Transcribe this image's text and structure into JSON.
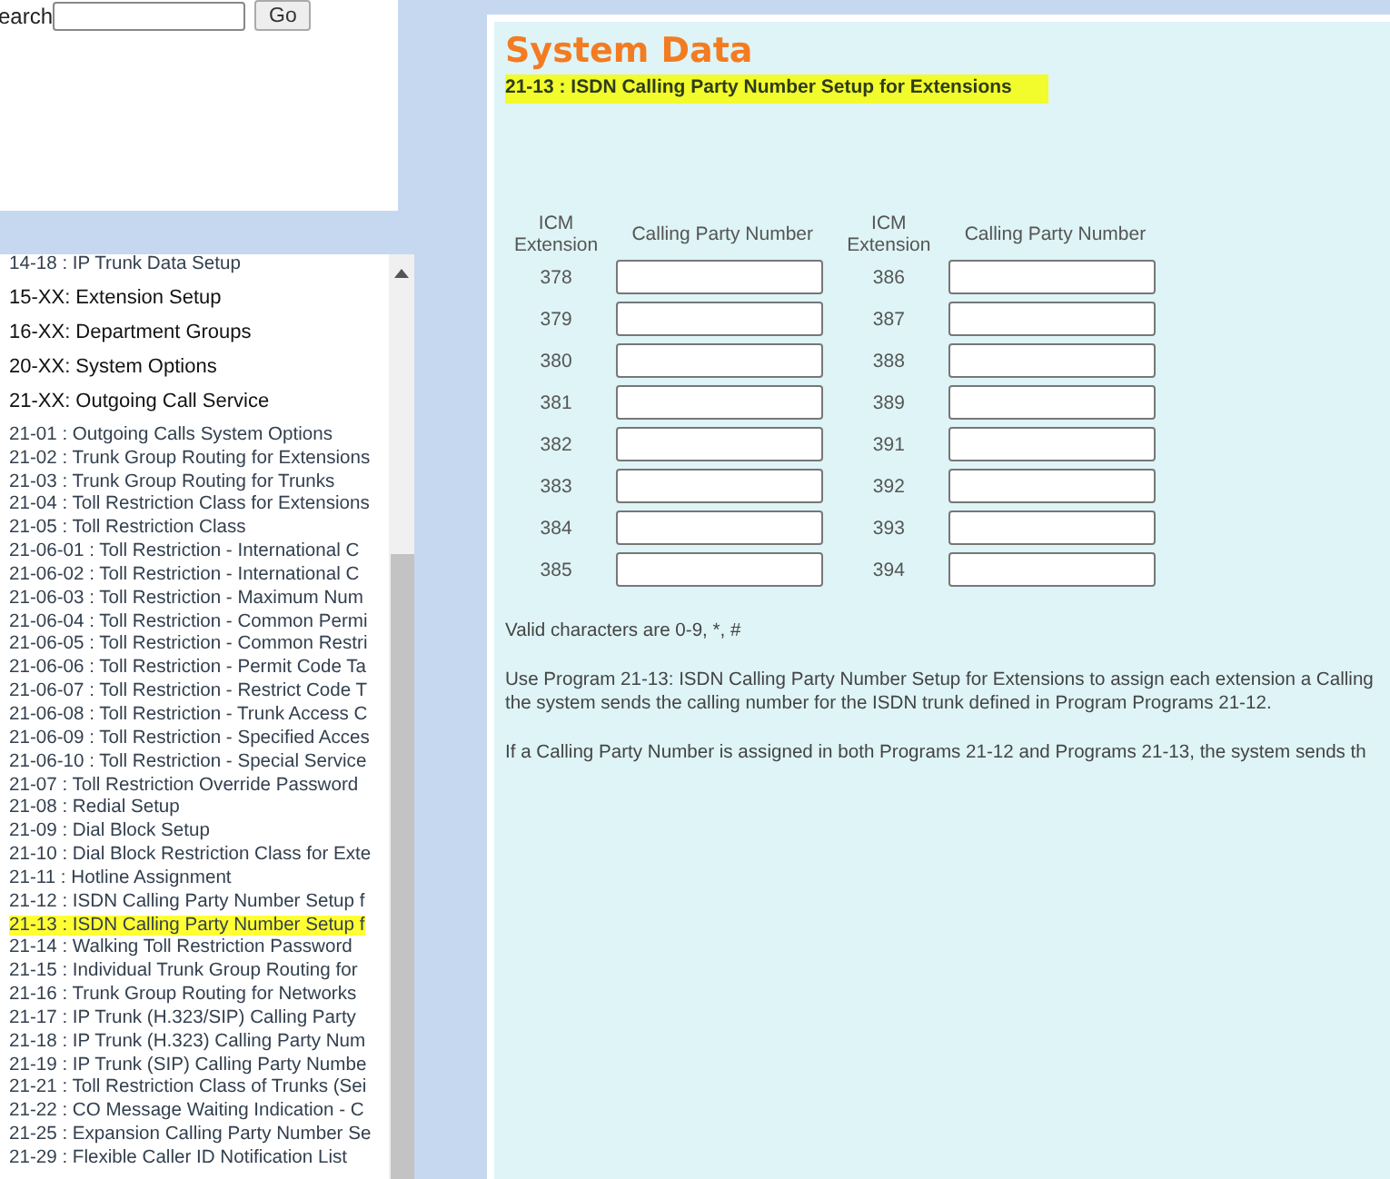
{
  "search": {
    "label": "earch",
    "button": "Go"
  },
  "nav": {
    "items": [
      {
        "kind": "item",
        "label": "14-18 : IP Trunk Data Setup",
        "selected": false
      },
      {
        "kind": "heading",
        "label": "15-XX: Extension Setup",
        "selected": false
      },
      {
        "kind": "heading",
        "label": "16-XX: Department Groups",
        "selected": false
      },
      {
        "kind": "heading",
        "label": "20-XX: System Options",
        "selected": false
      },
      {
        "kind": "heading",
        "label": "21-XX: Outgoing Call Service",
        "selected": false
      },
      {
        "kind": "item",
        "label": "21-01 : Outgoing Calls System Options",
        "selected": false
      },
      {
        "kind": "item",
        "label": "21-02 : Trunk Group Routing for Extensions",
        "selected": false
      },
      {
        "kind": "item",
        "label": "21-03 : Trunk Group Routing for Trunks",
        "selected": false
      },
      {
        "kind": "item",
        "label": "21-04 : Toll Restriction Class for Extensions",
        "selected": false
      },
      {
        "kind": "item",
        "label": "21-05 : Toll Restriction Class",
        "selected": false
      },
      {
        "kind": "item",
        "label": "21-06-01 : Toll Restriction - International C",
        "selected": false
      },
      {
        "kind": "item",
        "label": "21-06-02 : Toll Restriction - International C",
        "selected": false
      },
      {
        "kind": "item",
        "label": "21-06-03 : Toll Restriction - Maximum Num",
        "selected": false
      },
      {
        "kind": "item",
        "label": "21-06-04 : Toll Restriction - Common Permi",
        "selected": false
      },
      {
        "kind": "item",
        "label": "21-06-05 : Toll Restriction - Common Restri",
        "selected": false
      },
      {
        "kind": "item",
        "label": "21-06-06 : Toll Restriction - Permit Code Ta",
        "selected": false
      },
      {
        "kind": "item",
        "label": "21-06-07 : Toll Restriction - Restrict Code T",
        "selected": false
      },
      {
        "kind": "item",
        "label": "21-06-08 : Toll Restriction - Trunk Access C",
        "selected": false
      },
      {
        "kind": "item",
        "label": "21-06-09 : Toll Restriction - Specified Acces",
        "selected": false
      },
      {
        "kind": "item",
        "label": "21-06-10 : Toll Restriction - Special Service",
        "selected": false
      },
      {
        "kind": "item",
        "label": "21-07 : Toll Restriction Override Password",
        "selected": false
      },
      {
        "kind": "item",
        "label": "21-08 : Redial Setup",
        "selected": false
      },
      {
        "kind": "item",
        "label": "21-09 : Dial Block Setup",
        "selected": false
      },
      {
        "kind": "item",
        "label": "21-10 : Dial Block Restriction Class for Exte",
        "selected": false
      },
      {
        "kind": "item",
        "label": "21-11 : Hotline Assignment",
        "selected": false
      },
      {
        "kind": "item",
        "label": "21-12 : ISDN Calling Party Number Setup f",
        "selected": false
      },
      {
        "kind": "item",
        "label": "21-13 : ISDN Calling Party Number Setup f",
        "selected": true
      },
      {
        "kind": "item",
        "label": "21-14 : Walking Toll Restriction Password",
        "selected": false
      },
      {
        "kind": "item",
        "label": "21-15 : Individual Trunk Group Routing for",
        "selected": false
      },
      {
        "kind": "item",
        "label": "21-16 : Trunk Group Routing for Networks",
        "selected": false
      },
      {
        "kind": "item",
        "label": "21-17 : IP Trunk (H.323/SIP) Calling Party",
        "selected": false
      },
      {
        "kind": "item",
        "label": "21-18 : IP Trunk (H.323) Calling Party Num",
        "selected": false
      },
      {
        "kind": "item",
        "label": "21-19 : IP Trunk (SIP) Calling Party Numbe",
        "selected": false
      },
      {
        "kind": "item",
        "label": "21-21 : Toll Restriction Class of Trunks (Sei",
        "selected": false
      },
      {
        "kind": "item",
        "label": "21-22 : CO Message Waiting Indication - C",
        "selected": false
      },
      {
        "kind": "item",
        "label": "21-25 : Expansion Calling Party Number Se",
        "selected": false
      },
      {
        "kind": "item",
        "label": "21-29 : Flexible Caller ID Notification List",
        "selected": false
      }
    ]
  },
  "main": {
    "title": "System Data",
    "subtitle": "21-13 : ISDN Calling Party Number Setup for Extensions",
    "table": {
      "columns": [
        "ICM Extension",
        "Calling Party Number",
        "ICM Extension",
        "Calling Party Number"
      ],
      "rows": [
        [
          "378",
          "386"
        ],
        [
          "379",
          "387"
        ],
        [
          "380",
          "388"
        ],
        [
          "381",
          "389"
        ],
        [
          "382",
          "391"
        ],
        [
          "383",
          "392"
        ],
        [
          "384",
          "393"
        ],
        [
          "385",
          "394"
        ]
      ]
    },
    "notes": [
      {
        "lines": [
          "Valid characters are 0-9, *, #"
        ]
      },
      {
        "lines": [
          "Use Program 21-13: ISDN Calling Party Number Setup for Extensions to assign each extension a Calling",
          "the system sends the calling number for the ISDN trunk defined in Program Programs 21-12."
        ]
      },
      {
        "lines": [
          "If a Calling Party Number is assigned in both Programs 21-12 and Programs 21-13, the system sends th"
        ]
      }
    ]
  }
}
